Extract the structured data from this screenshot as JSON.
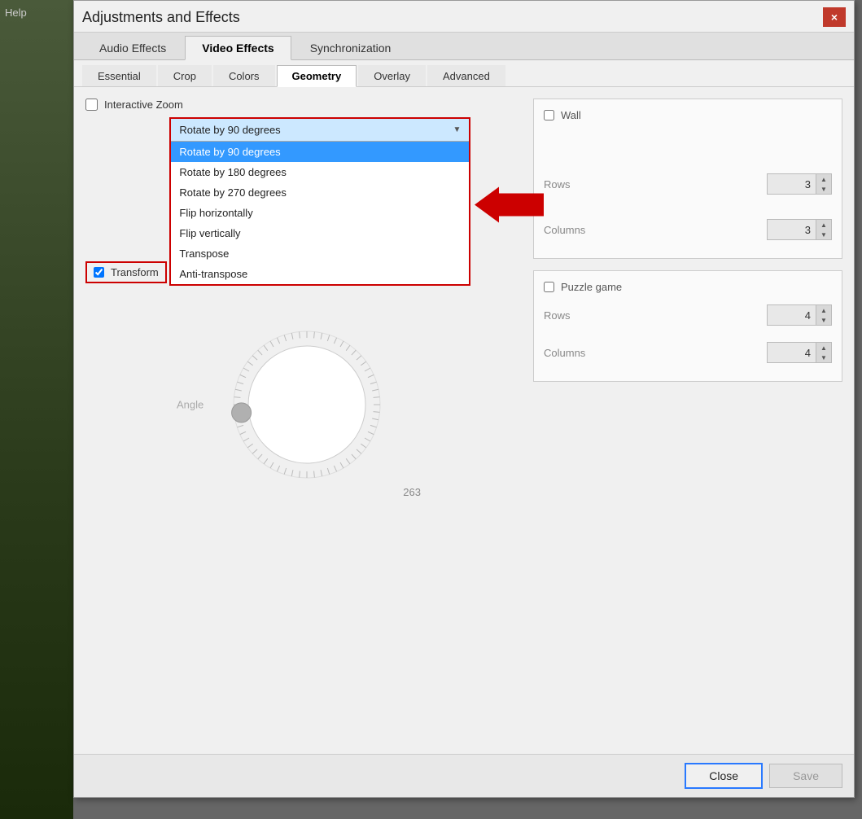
{
  "bg": {
    "help_label": "Help"
  },
  "dialog": {
    "title": "Adjustments and Effects",
    "close_btn": "×"
  },
  "main_tabs": [
    {
      "id": "audio",
      "label": "Audio Effects",
      "active": false
    },
    {
      "id": "video",
      "label": "Video Effects",
      "active": true
    },
    {
      "id": "sync",
      "label": "Synchronization",
      "active": false
    }
  ],
  "sub_tabs": [
    {
      "id": "essential",
      "label": "Essential",
      "active": false
    },
    {
      "id": "crop",
      "label": "Crop",
      "active": false
    },
    {
      "id": "colors",
      "label": "Colors",
      "active": false
    },
    {
      "id": "geometry",
      "label": "Geometry",
      "active": true
    },
    {
      "id": "overlay",
      "label": "Overlay",
      "active": false
    },
    {
      "id": "advanced",
      "label": "Advanced",
      "active": false
    }
  ],
  "left_panel": {
    "interactive_zoom_label": "Interactive Zoom",
    "transform_label": "Transform",
    "transform_checked": true,
    "interactive_zoom_checked": false,
    "dropdown_selected": "Rotate by 90 degrees",
    "dropdown_items": [
      {
        "label": "Rotate by 90 degrees",
        "selected": true
      },
      {
        "label": "Rotate by 180 degrees",
        "selected": false
      },
      {
        "label": "Rotate by 270 degrees",
        "selected": false
      },
      {
        "label": "Flip horizontally",
        "selected": false
      },
      {
        "label": "Flip vertically",
        "selected": false
      },
      {
        "label": "Transpose",
        "selected": false
      },
      {
        "label": "Anti-transpose",
        "selected": false
      }
    ],
    "angle_label": "Angle",
    "angle_value": "263"
  },
  "right_panel": {
    "wall_label": "Wall",
    "wall_checked": false,
    "rows_label": "Rows",
    "rows_value": "3",
    "columns_label": "Columns",
    "columns_value": "3",
    "puzzle_label": "Puzzle game",
    "puzzle_checked": false,
    "puzzle_rows_label": "Rows",
    "puzzle_rows_value": "4",
    "puzzle_columns_label": "Columns",
    "puzzle_columns_value": "4"
  },
  "bottom_bar": {
    "close_label": "Close",
    "save_label": "Save"
  }
}
